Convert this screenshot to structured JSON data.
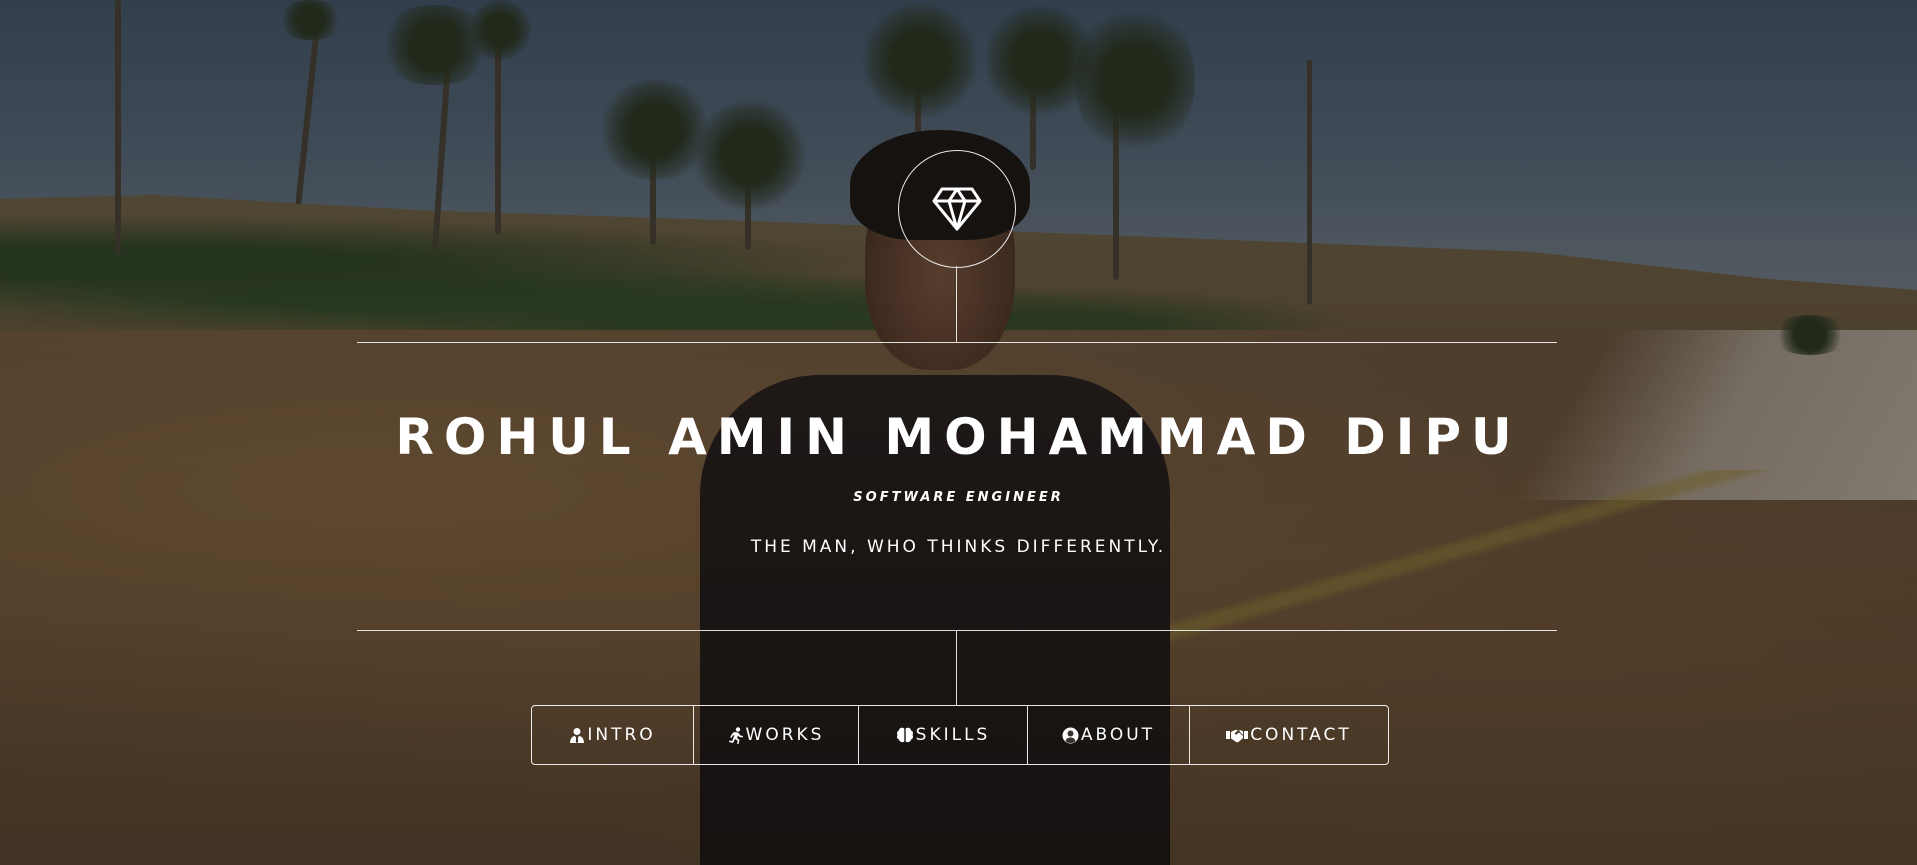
{
  "header": {
    "name": "ROHUL AMIN MOHAMMAD DIPU",
    "role": "SOFTWARE ENGINEER",
    "tagline": "THE MAN, WHO THINKS DIFFERENTLY."
  },
  "logo": {
    "icon": "diamond-icon"
  },
  "nav": {
    "items": [
      {
        "label": "INTRO",
        "icon": "user-tie-icon"
      },
      {
        "label": "WORKS",
        "icon": "running-icon"
      },
      {
        "label": "SKILLS",
        "icon": "brain-icon"
      },
      {
        "label": "ABOUT",
        "icon": "user-circle-icon"
      },
      {
        "label": "CONTACT",
        "icon": "handshake-icon"
      }
    ]
  },
  "colors": {
    "text": "#ffffff",
    "lines": "#ffffff",
    "overlay": "rgba(0,0,0,0.28)"
  }
}
